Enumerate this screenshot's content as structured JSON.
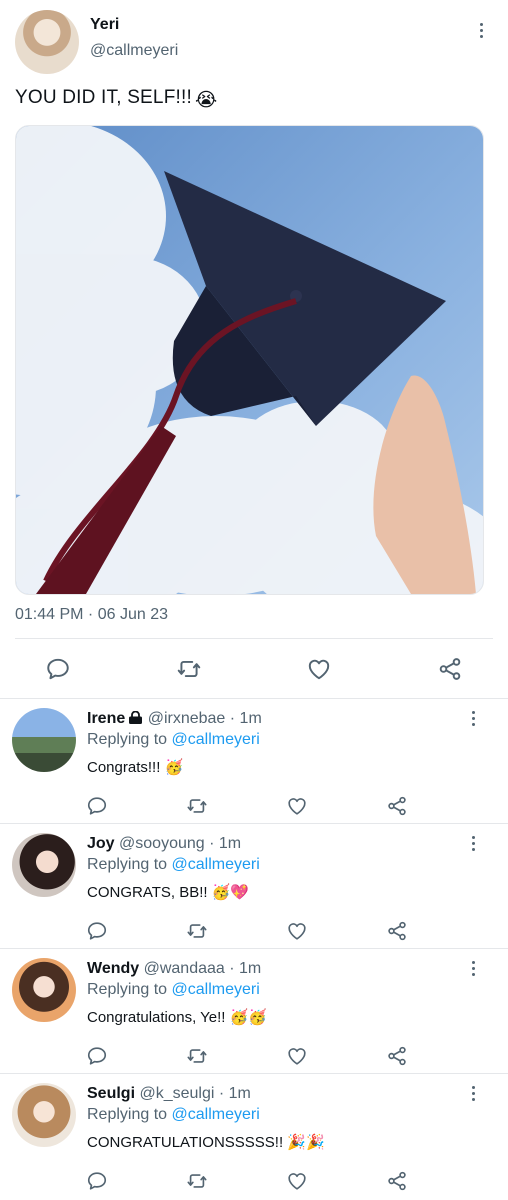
{
  "tweet": {
    "author_name": "Yeri",
    "author_handle": "@callmeyeri",
    "text": "YOU DID IT, SELF!!!",
    "text_emoji": "😭",
    "timestamp": "01:44 PM · 06 Jun 23",
    "image_alt": "graduation-cap-photo"
  },
  "replies": [
    {
      "name": "Irene",
      "handle": "@irxnebae",
      "time": "· 1m",
      "protected": true,
      "replying_label": "Replying to",
      "replying_to": "@callmeyeri",
      "text": "Congrats!!!",
      "emoji": "🥳"
    },
    {
      "name": "Joy",
      "handle": "@sooyoung",
      "time": "· 1m",
      "protected": false,
      "replying_label": "Replying to",
      "replying_to": "@callmeyeri",
      "text": "CONGRATS, BB!!",
      "emoji": "🥳💖"
    },
    {
      "name": "Wendy",
      "handle": "@wandaaa",
      "time": "· 1m",
      "protected": false,
      "replying_label": "Replying to",
      "replying_to": "@callmeyeri",
      "text": "Congratulations, Ye!!",
      "emoji": "🥳🥳"
    },
    {
      "name": "Seulgi",
      "handle": "@k_seulgi",
      "time": "· 1m",
      "protected": false,
      "replying_label": "Replying to",
      "replying_to": "@callmeyeri",
      "text": "CONGRATULATIONSSSSS!!",
      "emoji": "🎉🎉"
    }
  ],
  "colors": {
    "accent": "#1d9bf0",
    "muted": "#536471",
    "divider": "#e5e7ea"
  },
  "icons": [
    "more-vertical-icon",
    "reply-icon",
    "retweet-icon",
    "like-icon",
    "share-icon",
    "lock-icon"
  ]
}
